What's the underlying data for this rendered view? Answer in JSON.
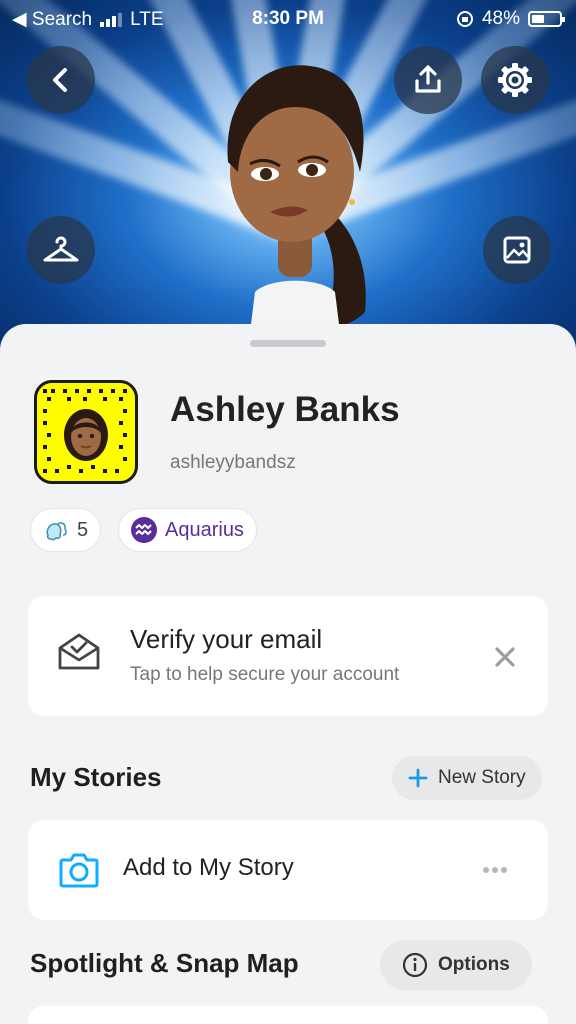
{
  "status_bar": {
    "back_app": "◀ Search",
    "network": "LTE",
    "time": "8:30 PM",
    "battery": "48%"
  },
  "colors": {
    "snap_yellow": "#fffc00",
    "accent_blue": "#0fadff",
    "aquarius_purple": "#5b2d9b"
  },
  "profile": {
    "name": "Ashley Banks",
    "username": "ashleyybandsz",
    "friends_count": "5",
    "zodiac": "Aquarius"
  },
  "verify_card": {
    "title": "Verify your email",
    "subtitle": "Tap to help secure your account"
  },
  "my_stories": {
    "title": "My Stories",
    "new_story_label": "New Story",
    "add_label": "Add to My Story"
  },
  "spotlight": {
    "title": "Spotlight & Snap Map",
    "options_label": "Options"
  },
  "icons": [
    "back-icon",
    "share-icon",
    "gear-icon",
    "hanger-icon",
    "photo-icon",
    "friends-icon",
    "aquarius-icon",
    "envelope-icon",
    "close-icon",
    "plus-icon",
    "camera-icon",
    "more-icon",
    "info-icon"
  ]
}
